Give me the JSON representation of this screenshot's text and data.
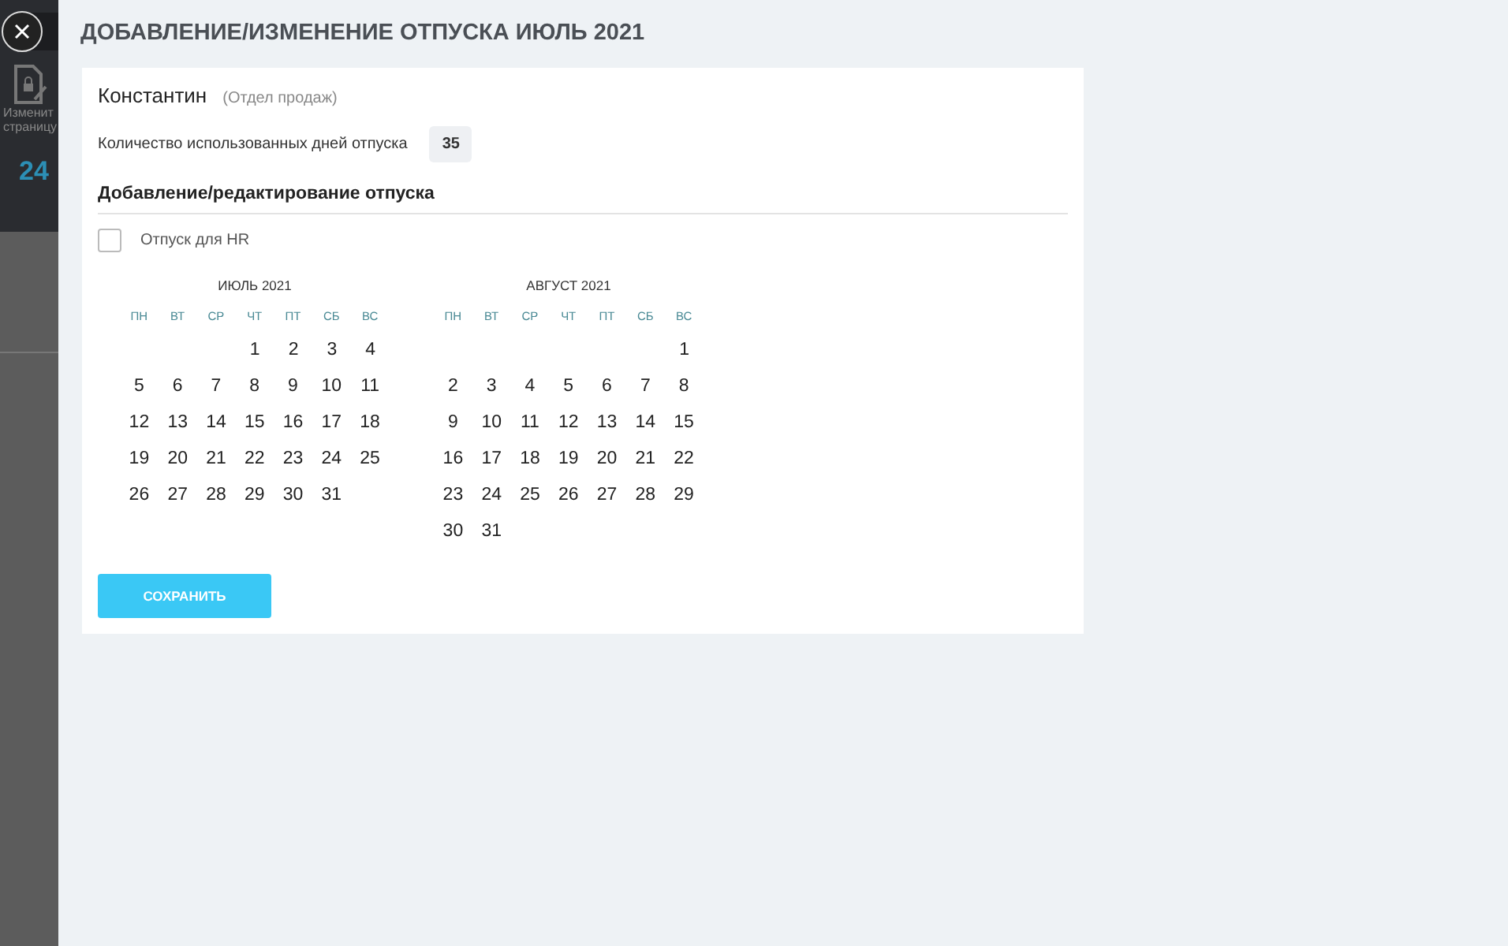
{
  "background": {
    "edit_label": [
      "Изменит",
      "страницу"
    ],
    "counter_value": "24"
  },
  "title": "ДОБАВЛЕНИЕ/ИЗМЕНЕНИЕ ОТПУСКА ИЮЛЬ 2021",
  "employee": {
    "name": "Константин",
    "department": "(Отдел продаж)"
  },
  "used_days": {
    "label": "Количество использованных дней отпуска",
    "value": "35"
  },
  "section_title": "Добавление/редактирование отпуска",
  "hr_checkbox": {
    "label": "Отпуск для HR",
    "checked": false
  },
  "calendars": [
    {
      "month": "ИЮЛЬ 2021",
      "weekdays": [
        "ПН",
        "ВТ",
        "СР",
        "ЧТ",
        "ПТ",
        "СБ",
        "ВС"
      ],
      "weeks": [
        {
          "right_aligned": true,
          "days": [
            "1",
            "2",
            "3",
            "4"
          ]
        },
        {
          "right_aligned": false,
          "days": [
            "5",
            "6",
            "7",
            "8",
            "9",
            "10",
            "11"
          ]
        },
        {
          "right_aligned": false,
          "days": [
            "12",
            "13",
            "14",
            "15",
            "16",
            "17",
            "18"
          ]
        },
        {
          "right_aligned": false,
          "days": [
            "19",
            "20",
            "21",
            "22",
            "23",
            "24",
            "25"
          ]
        },
        {
          "right_aligned": false,
          "days": [
            "26",
            "27",
            "28",
            "29",
            "30",
            "31"
          ]
        }
      ]
    },
    {
      "month": "АВГУСТ 2021",
      "weekdays": [
        "ПН",
        "ВТ",
        "СР",
        "ЧТ",
        "ПТ",
        "СБ",
        "ВС"
      ],
      "weeks": [
        {
          "right_aligned": true,
          "days": [
            "1"
          ]
        },
        {
          "right_aligned": false,
          "days": [
            "2",
            "3",
            "4",
            "5",
            "6",
            "7",
            "8"
          ]
        },
        {
          "right_aligned": false,
          "days": [
            "9",
            "10",
            "11",
            "12",
            "13",
            "14",
            "15"
          ]
        },
        {
          "right_aligned": false,
          "days": [
            "16",
            "17",
            "18",
            "19",
            "20",
            "21",
            "22"
          ]
        },
        {
          "right_aligned": false,
          "days": [
            "23",
            "24",
            "25",
            "26",
            "27",
            "28",
            "29"
          ]
        },
        {
          "right_aligned": false,
          "days": [
            "30",
            "31"
          ]
        }
      ]
    }
  ],
  "save_button": "СОХРАНИТЬ"
}
